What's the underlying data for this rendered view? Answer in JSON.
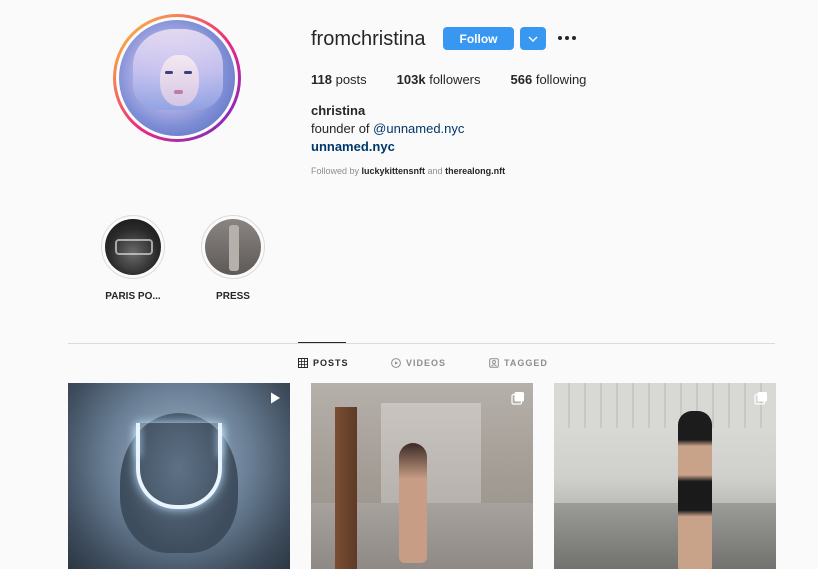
{
  "profile": {
    "username": "fromchristina",
    "follow_label": "Follow",
    "full_name": "christina",
    "bio_prefix": "founder of ",
    "bio_mention": "@unnamed.nyc",
    "website": "unnamed.nyc",
    "followed_by_prefix": "Followed by ",
    "followed_by_1": "luckykittensnft",
    "followed_by_and": " and ",
    "followed_by_2": "therealong.nft"
  },
  "stats": {
    "posts_count": "118",
    "posts_label": " posts",
    "followers_count": "103k",
    "followers_label": " followers",
    "following_count": "566",
    "following_label": " following"
  },
  "highlights": [
    {
      "label": "PARIS PO..."
    },
    {
      "label": "PRESS"
    }
  ],
  "tabs": [
    {
      "label": "POSTS",
      "icon": "grid-icon",
      "active": true
    },
    {
      "label": "VIDEOS",
      "icon": "video-icon",
      "active": false
    },
    {
      "label": "TAGGED",
      "icon": "tag-icon",
      "active": false
    }
  ],
  "posts": [
    {
      "type": "video",
      "icon": "play-icon"
    },
    {
      "type": "carousel",
      "icon": "carousel-icon"
    },
    {
      "type": "carousel",
      "icon": "carousel-icon"
    }
  ],
  "colors": {
    "accent": "#3897f0",
    "link": "#00376b",
    "muted": "#8e8e8e",
    "text": "#262626"
  }
}
